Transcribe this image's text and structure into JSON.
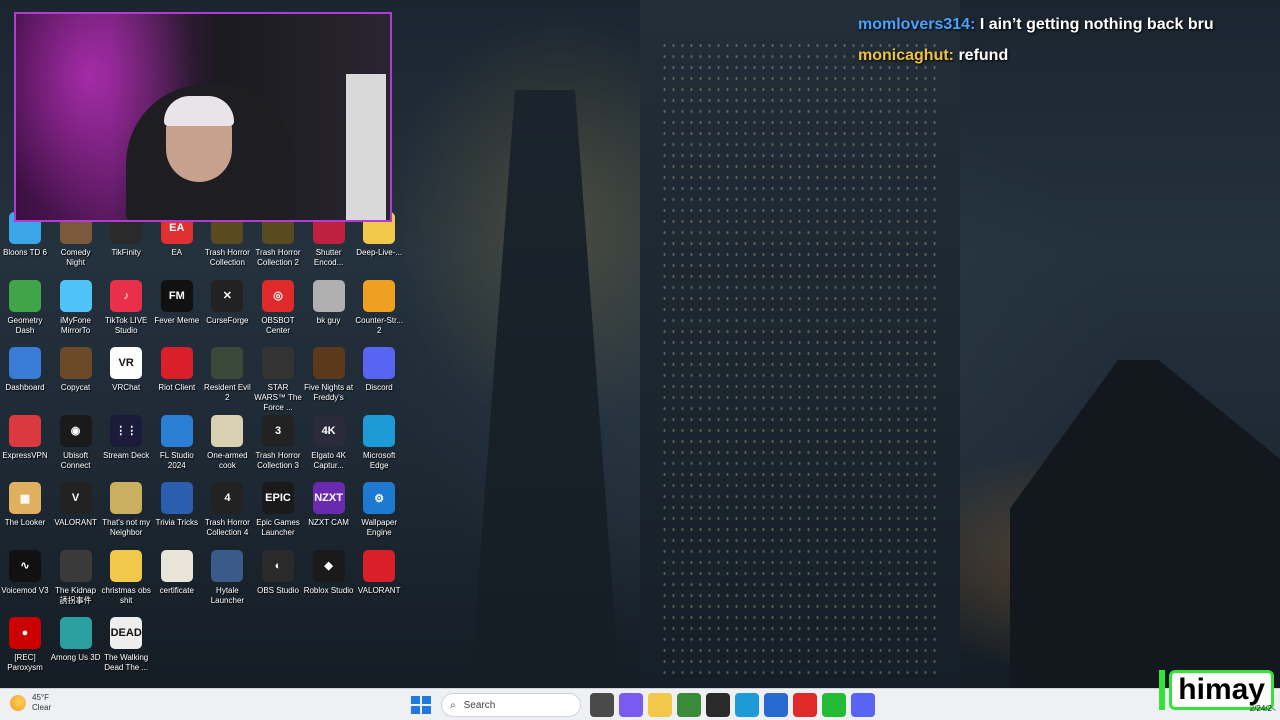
{
  "chat": [
    {
      "user": "momlovers314:",
      "message": "I ain’t getting nothing back bru",
      "color": "#4aa3ff"
    },
    {
      "user": "monicaghut:",
      "message": "refund",
      "color": "#f0c040"
    }
  ],
  "desktop_icons": [
    {
      "label": "Bloons TD 6",
      "icon": "bloons-icon",
      "color": "#3aa6e8",
      "text": ""
    },
    {
      "label": "Comedy Night",
      "icon": "comedy-night-icon",
      "color": "#7a5a3a",
      "text": ""
    },
    {
      "label": "TikFinity",
      "icon": "tikfinity-icon",
      "color": "#2a2a2a",
      "text": ""
    },
    {
      "label": "EA",
      "icon": "ea-icon",
      "color": "#e03030",
      "text": "EA"
    },
    {
      "label": "Trash Horror Collection",
      "icon": "trash-horror-icon",
      "color": "#5a4a20",
      "text": ""
    },
    {
      "label": "Trash Horror Collection 2",
      "icon": "trash-horror-2-icon",
      "color": "#5a4a20",
      "text": ""
    },
    {
      "label": "Shutter Encod...",
      "icon": "shutter-encoder-icon",
      "color": "#c02040",
      "text": ""
    },
    {
      "label": "Deep-Live-...",
      "icon": "folder-icon",
      "color": "#f2c84b",
      "text": ""
    },
    {
      "label": "Geometry Dash",
      "icon": "geometry-dash-icon",
      "color": "#3fa548",
      "text": ""
    },
    {
      "label": "iMyFone MirrorTo",
      "icon": "imyfone-icon",
      "color": "#4fc3f7",
      "text": ""
    },
    {
      "label": "TikTok LIVE Studio",
      "icon": "tiktok-icon",
      "color": "#e8304a",
      "text": "♪"
    },
    {
      "label": "Fever Meme",
      "icon": "fever-meme-icon",
      "color": "#111111",
      "text": "FM"
    },
    {
      "label": "CurseForge",
      "icon": "curseforge-icon",
      "color": "#222222",
      "text": "✕"
    },
    {
      "label": "OBSBOT Center",
      "icon": "obsbot-icon",
      "color": "#e02a2a",
      "text": "◎"
    },
    {
      "label": "bk guy",
      "icon": "bk-guy-icon",
      "color": "#b0b0b0",
      "text": ""
    },
    {
      "label": "Counter-Str... 2",
      "icon": "counter-strike-icon",
      "color": "#f0a020",
      "text": ""
    },
    {
      "label": "Dashboard",
      "icon": "dashboard-icon",
      "color": "#3b7bd8",
      "text": ""
    },
    {
      "label": "Copycat",
      "icon": "copycat-icon",
      "color": "#6b4a2a",
      "text": ""
    },
    {
      "label": "VRChat",
      "icon": "vrchat-icon",
      "color": "#ffffff",
      "text": "VR"
    },
    {
      "label": "Riot Client",
      "icon": "riot-client-icon",
      "color": "#d81f2a",
      "text": ""
    },
    {
      "label": "Resident Evil 2",
      "icon": "resident-evil-icon",
      "color": "#3a4a3a",
      "text": ""
    },
    {
      "label": "STAR WARS™ The Force ...",
      "icon": "star-wars-icon",
      "color": "#333333",
      "text": ""
    },
    {
      "label": "Five Nights at Freddy's",
      "icon": "fnaf-icon",
      "color": "#5a3a1a",
      "text": ""
    },
    {
      "label": "Discord",
      "icon": "discord-icon",
      "color": "#5865f2",
      "text": ""
    },
    {
      "label": "ExpressVPN",
      "icon": "expressvpn-icon",
      "color": "#da3940",
      "text": ""
    },
    {
      "label": "Ubisoft Connect",
      "icon": "ubisoft-icon",
      "color": "#1a1a1a",
      "text": "◉"
    },
    {
      "label": "Stream Deck",
      "icon": "stream-deck-icon",
      "color": "#1c1c3a",
      "text": "⋮⋮"
    },
    {
      "label": "FL Studio 2024",
      "icon": "fl-studio-icon",
      "color": "#2a7fd4",
      "text": ""
    },
    {
      "label": "One-armed cook",
      "icon": "one-armed-cook-icon",
      "color": "#d8d0b0",
      "text": ""
    },
    {
      "label": "Trash Horror Collection 3",
      "icon": "trash-horror-3-icon",
      "color": "#222222",
      "text": "3"
    },
    {
      "label": "Elgato 4K Captur...",
      "icon": "elgato-icon",
      "color": "#2a2a3a",
      "text": "4K"
    },
    {
      "label": "Microsoft Edge",
      "icon": "edge-icon",
      "color": "#1e9ad6",
      "text": ""
    },
    {
      "label": "The Looker",
      "icon": "looker-icon",
      "color": "#e0b060",
      "text": "▦"
    },
    {
      "label": "VALORANT",
      "icon": "valorant-icon",
      "color": "#222222",
      "text": "V"
    },
    {
      "label": "That's not my Neighbor",
      "icon": "neighbor-icon",
      "color": "#c8b060",
      "text": ""
    },
    {
      "label": "Trivia Tricks",
      "icon": "trivia-tricks-icon",
      "color": "#2a5fb0",
      "text": ""
    },
    {
      "label": "Trash Horror Collection 4",
      "icon": "trash-horror-4-icon",
      "color": "#222222",
      "text": "4"
    },
    {
      "label": "Epic Games Launcher",
      "icon": "epic-games-icon",
      "color": "#1a1a1a",
      "text": "EPIC"
    },
    {
      "label": "NZXT CAM",
      "icon": "nzxt-icon",
      "color": "#6a2ab0",
      "text": "NZXT"
    },
    {
      "label": "Wallpaper Engine",
      "icon": "wallpaper-engine-icon",
      "color": "#1e7ad0",
      "text": "⚙"
    },
    {
      "label": "Voicemod V3",
      "icon": "voicemod-icon",
      "color": "#111111",
      "text": "∿"
    },
    {
      "label": "The Kidnap 誘拐事件",
      "icon": "kidnap-icon",
      "color": "#3a3a3a",
      "text": ""
    },
    {
      "label": "christmas obs shit",
      "icon": "folder-icon",
      "color": "#f2c84b",
      "text": ""
    },
    {
      "label": "certificate",
      "icon": "certificate-icon",
      "color": "#e8e4d8",
      "text": ""
    },
    {
      "label": "Hytale Launcher",
      "icon": "hytale-icon",
      "color": "#3a5a8a",
      "text": ""
    },
    {
      "label": "OBS Studio",
      "icon": "obs-icon",
      "color": "#2a2a2a",
      "text": "◐"
    },
    {
      "label": "Roblox Studio",
      "icon": "roblox-studio-icon",
      "color": "#1a1a1a",
      "text": "◆"
    },
    {
      "label": "VALORANT",
      "icon": "valorant-riot-icon",
      "color": "#d81f2a",
      "text": ""
    },
    {
      "label": "[REC] Paroxysm",
      "icon": "rec-paroxysm-icon",
      "color": "#cc0000",
      "text": "●"
    },
    {
      "label": "Among Us 3D",
      "icon": "among-us-icon",
      "color": "#2aa0a0",
      "text": ""
    },
    {
      "label": "The Walking Dead The ...",
      "icon": "walking-dead-icon",
      "color": "#eeeeee",
      "text": "DEAD"
    }
  ],
  "taskbar": {
    "weather_temp": "45°F",
    "weather_desc": "Clear",
    "search_placeholder": "Search",
    "apps": [
      {
        "icon": "task-view-icon",
        "color": "#4a4a4a"
      },
      {
        "icon": "copilot-icon",
        "color": "#7a5af0"
      },
      {
        "icon": "file-explorer-icon",
        "color": "#f2c84b"
      },
      {
        "icon": "chrome-icon",
        "color": "#3a8a3a"
      },
      {
        "icon": "obs-taskbar-icon",
        "color": "#2a2a2a"
      },
      {
        "icon": "edge-taskbar-icon",
        "color": "#1e9ad6"
      },
      {
        "icon": "store-icon",
        "color": "#2a6ad0"
      },
      {
        "icon": "youtube-icon",
        "color": "#e02a2a"
      },
      {
        "icon": "green-app-icon",
        "color": "#22bb33"
      },
      {
        "icon": "discord-taskbar-icon",
        "color": "#5865f2"
      }
    ],
    "clock": "2/24/2"
  },
  "brand_overlay": "himay"
}
